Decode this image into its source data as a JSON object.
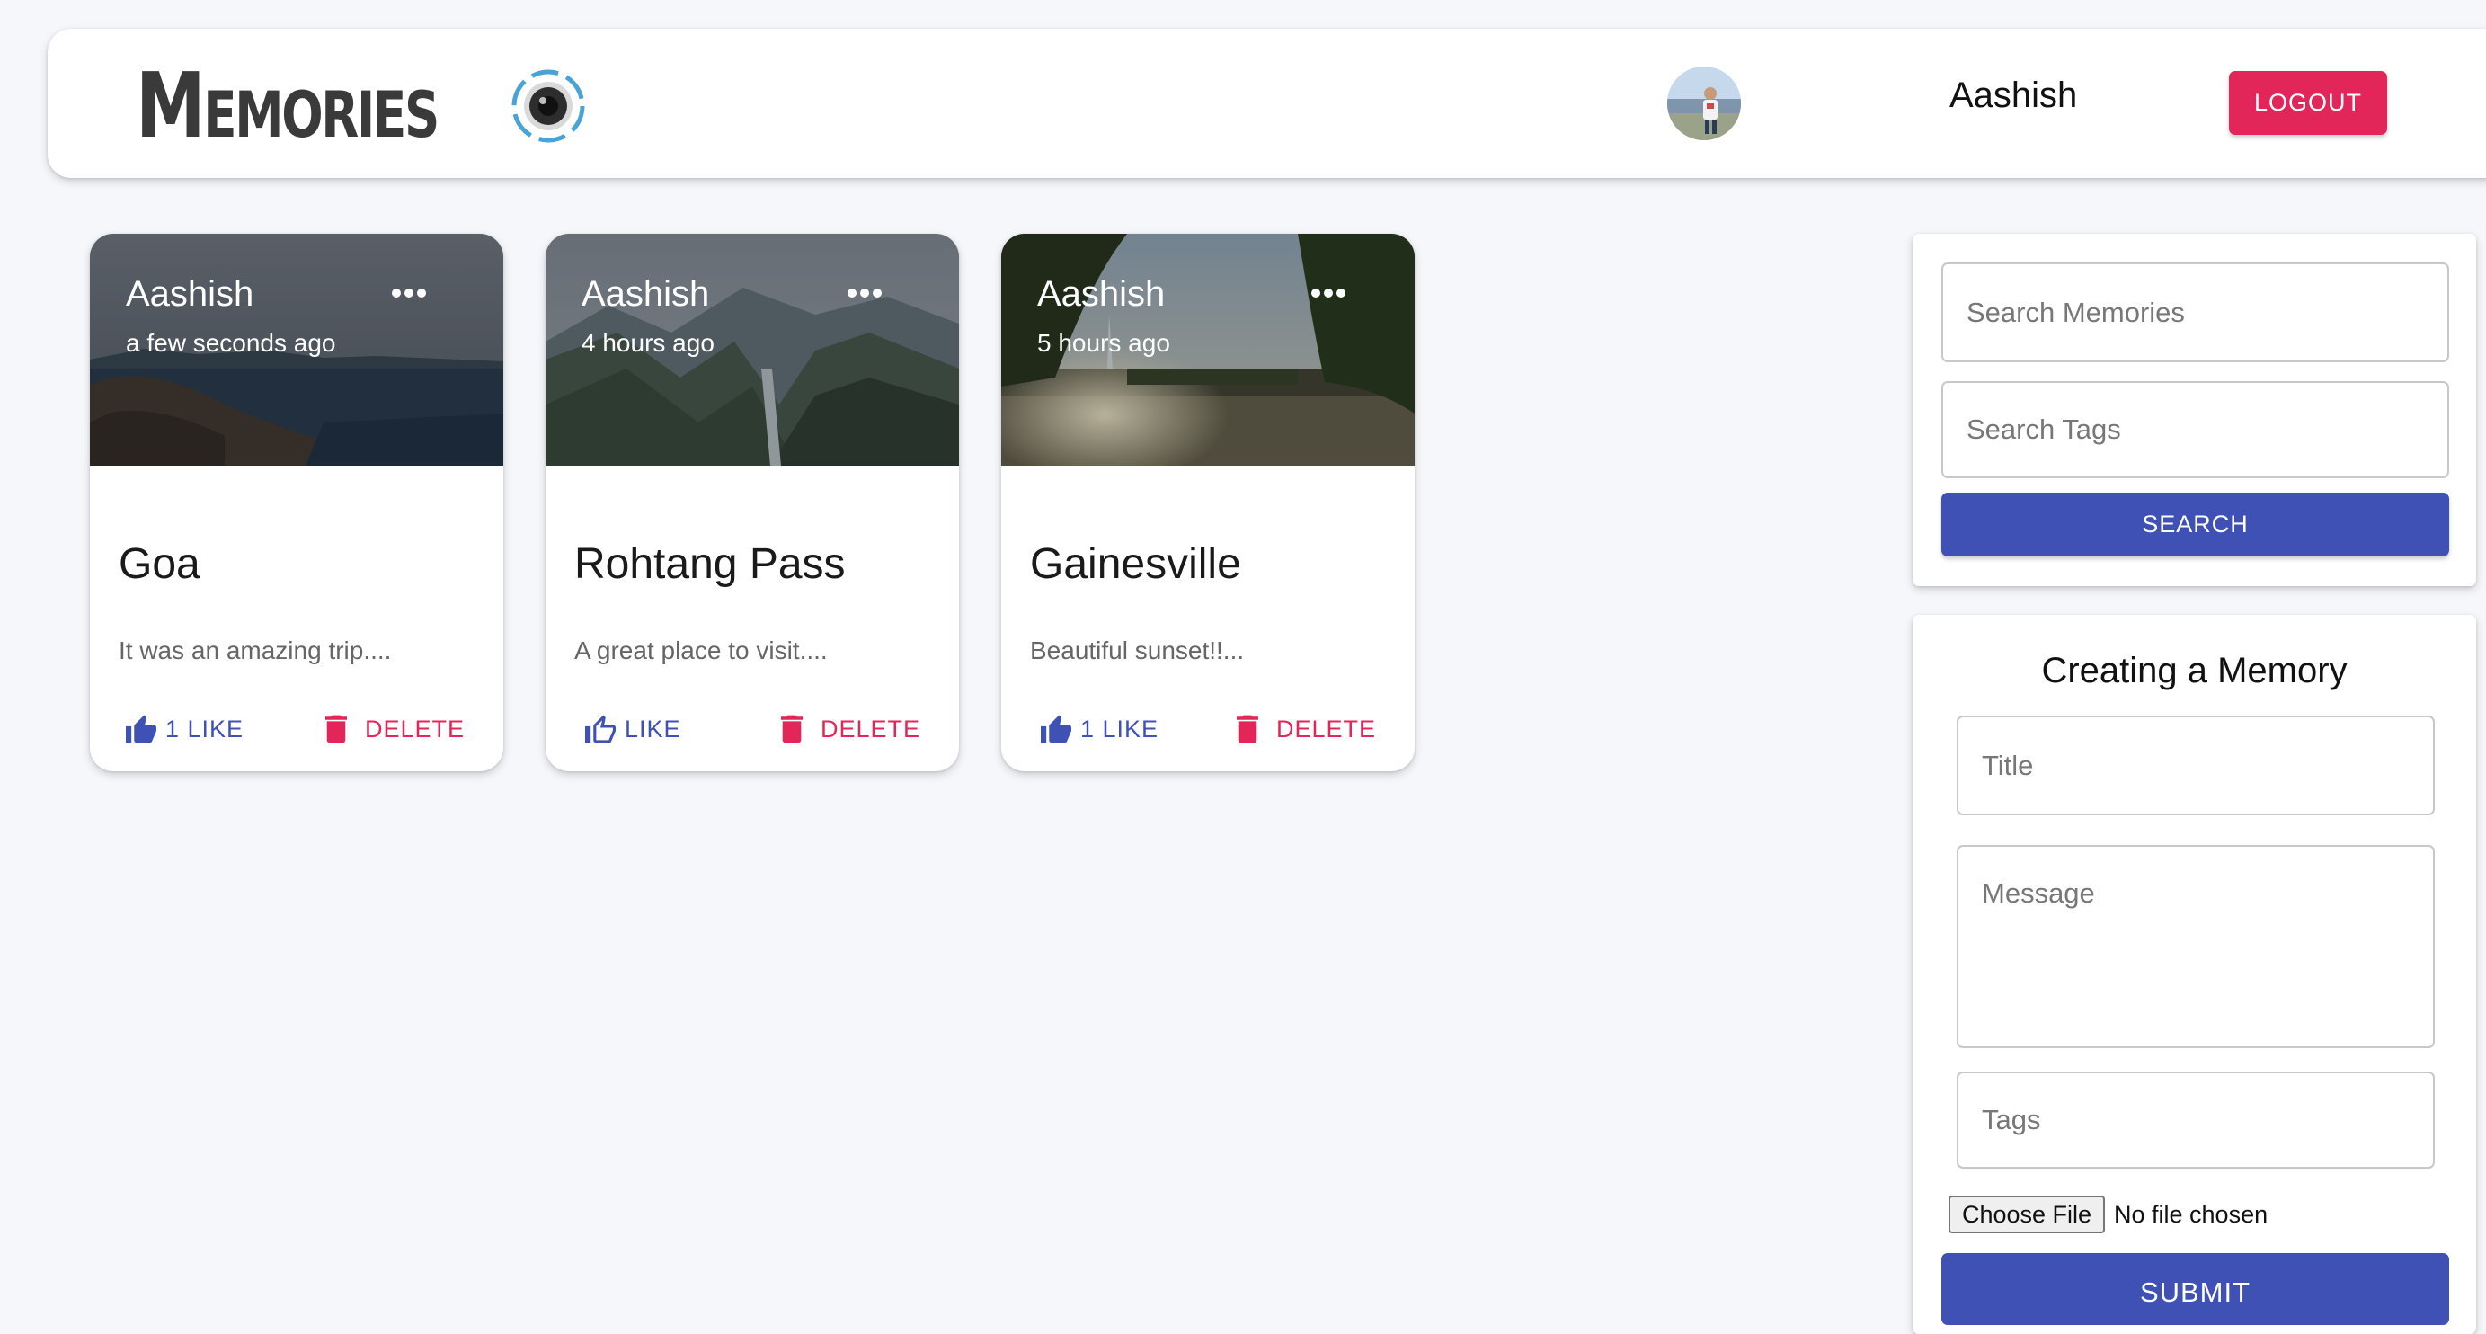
{
  "appbar": {
    "brand_title": "Memories",
    "brand_icon": "camera-lens-icon",
    "user_name": "Aashish",
    "logout_label": "LOGOUT"
  },
  "posts": [
    {
      "author": "Aashish",
      "time": "a few seconds ago",
      "title": "Goa",
      "message": "It was an amazing trip....",
      "like_label": "1 LIKE",
      "like_icon": "thumb-up-filled-icon",
      "delete_label": "DELETE",
      "more_icon": "more-horiz-icon"
    },
    {
      "author": "Aashish",
      "time": "4 hours ago",
      "title": "Rohtang Pass",
      "message": "A great place to visit....",
      "like_label": "LIKE",
      "like_icon": "thumb-up-outline-icon",
      "delete_label": "DELETE",
      "more_icon": "more-horiz-icon"
    },
    {
      "author": "Aashish",
      "time": "5 hours ago",
      "title": "Gainesville",
      "message": "Beautiful sunset!!...",
      "like_label": "1 LIKE",
      "like_icon": "thumb-up-filled-icon",
      "delete_label": "DELETE",
      "more_icon": "more-horiz-icon"
    }
  ],
  "search": {
    "memories_placeholder": "Search Memories",
    "tags_placeholder": "Search Tags",
    "button_label": "SEARCH"
  },
  "form": {
    "heading": "Creating a Memory",
    "title_placeholder": "Title",
    "message_placeholder": "Message",
    "tags_placeholder": "Tags",
    "file_button_label": "Choose File",
    "file_status": "No file chosen",
    "submit_label": "SUBMIT"
  },
  "colors": {
    "primary": "#3f51b5",
    "secondary": "#e2265a",
    "background": "#f6f7fb"
  }
}
